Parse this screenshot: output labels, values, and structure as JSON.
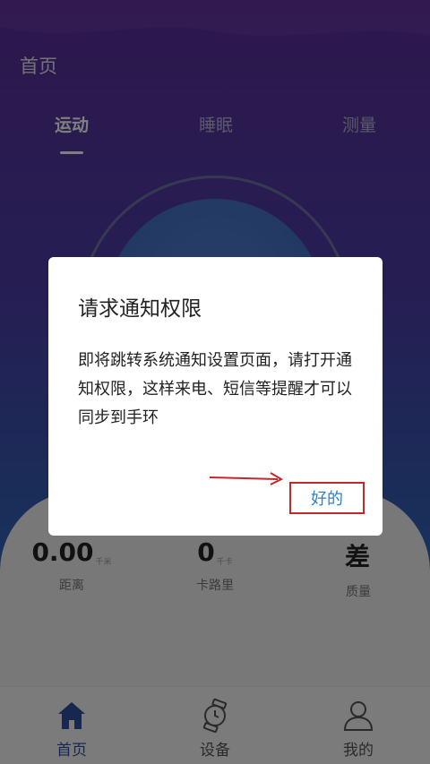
{
  "header": {
    "title": "首页"
  },
  "tabs": [
    {
      "label": "运动",
      "active": true
    },
    {
      "label": "睡眠",
      "active": false
    },
    {
      "label": "测量",
      "active": false
    }
  ],
  "stats": [
    {
      "value": "0.00",
      "unit": "千米",
      "label": "距离"
    },
    {
      "value": "0",
      "unit": "千卡",
      "label": "卡路里"
    },
    {
      "value": "差",
      "unit": "",
      "label": "质量"
    }
  ],
  "bottom_nav": [
    {
      "label": "首页",
      "icon": "home-icon",
      "active": true
    },
    {
      "label": "设备",
      "icon": "watch-icon",
      "active": false
    },
    {
      "label": "我的",
      "icon": "profile-icon",
      "active": false
    }
  ],
  "dialog": {
    "title": "请求通知权限",
    "message": "即将跳转系统通知设置页面，请打开通知权限，这样来电、短信等提醒才可以同步到手环",
    "ok_label": "好的"
  },
  "colors": {
    "accent": "#2d7fd0",
    "highlight": "#c4262a",
    "nav_active": "#2f4f9f"
  }
}
